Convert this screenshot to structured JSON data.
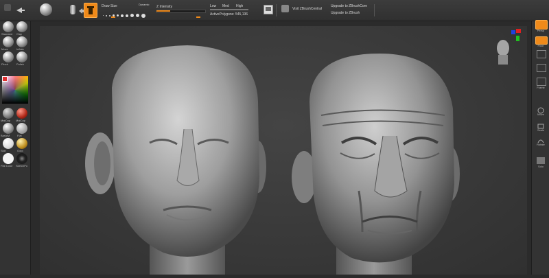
{
  "toolbar": {
    "draw_size_label": "Draw Size",
    "dynamic_label": "Dynamic",
    "z_intensity_label": "Z Intensity",
    "low_label": "Low",
    "med_label": "Med",
    "high_label": "High",
    "active_polygons_label": "ActivePolygons: 545,136",
    "visit_label": "Visit ZBrushCentral",
    "upgrade_core_label": "Upgrade to ZBrushCore",
    "upgrade_zbrush_label": "Upgrade to ZBrush"
  },
  "left_shelf": {
    "brush_labels": [
      "Standard",
      "Clay",
      "Move",
      "Inflate",
      "Pinch",
      "Polish"
    ],
    "material_labels": [
      "MatCap",
      "MatCap",
      "BasicM",
      "Flat",
      "Skin",
      "Gold",
      "Flat Color",
      "SketchPo"
    ]
  },
  "right_shelf": {
    "labels": [
      "Persp",
      "Floor",
      "Frame",
      "Move",
      "Scale",
      "Rotate",
      "Solo"
    ]
  },
  "colors": {
    "accent": "#f08a1a",
    "background": "#2b2b2b",
    "panel": "#333333"
  }
}
